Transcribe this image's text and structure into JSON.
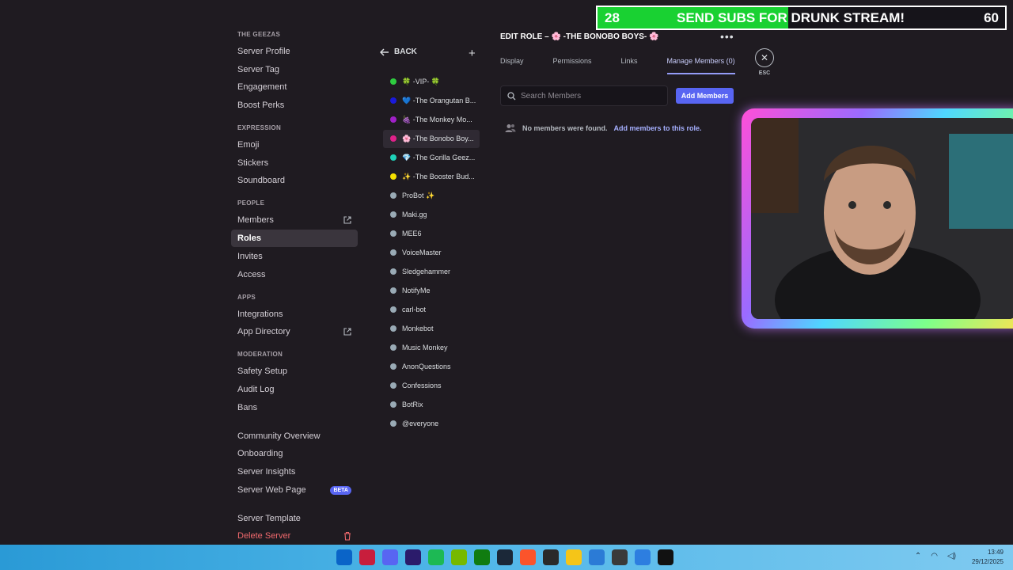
{
  "sidebar": {
    "sections": [
      {
        "category": "THE GEEZAS",
        "items": [
          {
            "label": "Server Profile"
          },
          {
            "label": "Server Tag"
          },
          {
            "label": "Engagement"
          },
          {
            "label": "Boost Perks"
          }
        ]
      },
      {
        "category": "EXPRESSION",
        "items": [
          {
            "label": "Emoji"
          },
          {
            "label": "Stickers"
          },
          {
            "label": "Soundboard"
          }
        ]
      },
      {
        "category": "PEOPLE",
        "items": [
          {
            "label": "Members",
            "external": true
          },
          {
            "label": "Roles",
            "active": true
          },
          {
            "label": "Invites"
          },
          {
            "label": "Access"
          }
        ]
      },
      {
        "category": "APPS",
        "items": [
          {
            "label": "Integrations"
          },
          {
            "label": "App Directory",
            "external": true
          }
        ]
      },
      {
        "category": "MODERATION",
        "items": [
          {
            "label": "Safety Setup"
          },
          {
            "label": "Audit Log"
          },
          {
            "label": "Bans"
          }
        ]
      },
      {
        "category": "",
        "items": [
          {
            "label": "Community Overview"
          },
          {
            "label": "Onboarding"
          },
          {
            "label": "Server Insights"
          },
          {
            "label": "Server Web Page",
            "badge": "BETA"
          }
        ]
      },
      {
        "category": "",
        "items": [
          {
            "label": "Server Template"
          },
          {
            "label": "Delete Server",
            "danger": true
          }
        ]
      }
    ]
  },
  "roles_panel": {
    "back_label": "BACK",
    "add_icon": "plus-icon",
    "roles": [
      {
        "name": "🍀 -VIP- 🍀",
        "color": "#2ecc40"
      },
      {
        "name": "💙 -The Orangutan B...",
        "color": "#1a1adb"
      },
      {
        "name": "🍇 -The Monkey Mo...",
        "color": "#a020c8"
      },
      {
        "name": "🌸 -The Bonobo Boy...",
        "color": "#e0218a",
        "active": true
      },
      {
        "name": "💎 -The Gorilla Geez...",
        "color": "#1fd1b8"
      },
      {
        "name": "✨ -The Booster Bud...",
        "color": "#f5e000"
      },
      {
        "name": "ProBot ✨",
        "color": "#99aab5"
      },
      {
        "name": "Maki.gg",
        "color": "#99aab5"
      },
      {
        "name": "MEE6",
        "color": "#99aab5"
      },
      {
        "name": "VoiceMaster",
        "color": "#99aab5"
      },
      {
        "name": "Sledgehammer",
        "color": "#99aab5"
      },
      {
        "name": "NotifyMe",
        "color": "#99aab5"
      },
      {
        "name": "carl-bot",
        "color": "#99aab5"
      },
      {
        "name": "Monkebot",
        "color": "#99aab5"
      },
      {
        "name": "Music Monkey",
        "color": "#99aab5"
      },
      {
        "name": "AnonQuestions",
        "color": "#99aab5"
      },
      {
        "name": "Confessions",
        "color": "#99aab5"
      },
      {
        "name": "BotRix",
        "color": "#99aab5"
      },
      {
        "name": "@everyone",
        "color": "#99aab5"
      }
    ]
  },
  "editor": {
    "title": "EDIT ROLE – 🌸 -THE BONOBO BOYS- 🌸",
    "more_icon": "•••",
    "tabs": [
      {
        "label": "Display"
      },
      {
        "label": "Permissions"
      },
      {
        "label": "Links"
      },
      {
        "label": "Manage Members (0)",
        "active": true
      }
    ],
    "close_label": "ESC",
    "search_placeholder": "Search Members",
    "add_button": "Add Members",
    "empty_text": "No members were found.",
    "empty_link": "Add members to this role."
  },
  "overlay": {
    "count": "28",
    "message": "SEND SUBS FOR DRUNK STREAM!",
    "goal": "60",
    "progress": 0.467
  },
  "taskbar": {
    "time": "13:49",
    "date": "29/12/2025",
    "icons": [
      "windows-start-icon",
      "opera-icon",
      "discord-icon",
      "premiere-icon",
      "spotify-icon",
      "nvidia-icon",
      "xbox-icon",
      "steam-icon",
      "brave-icon",
      "epic-games-icon",
      "file-explorer-icon",
      "notepad-icon",
      "obs-icon",
      "vscode-icon",
      "capcut-icon"
    ]
  },
  "colors": {
    "background": "#1f1b21",
    "accent": "#5865f2",
    "active_tab": "#949cf7",
    "danger": "#f0696d",
    "overlay_fill": "#19d132"
  }
}
